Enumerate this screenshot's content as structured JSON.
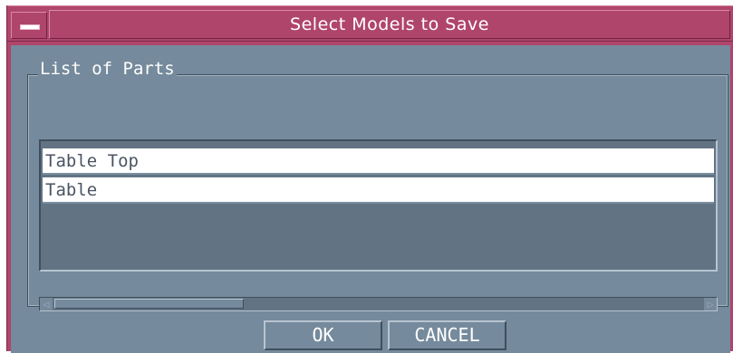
{
  "window": {
    "title": "Select Models to Save"
  },
  "parts_frame": {
    "label": "List of Parts",
    "items": [
      {
        "label": "Table Top"
      },
      {
        "label": "Table"
      }
    ]
  },
  "buttons": {
    "ok": "OK",
    "cancel": "CANCEL"
  },
  "colors": {
    "titlebar": "#b0456c",
    "client_bg": "#758a9c",
    "list_bg": "#627384",
    "item_bg": "#ffffff"
  },
  "icons": {
    "window_menu": "window-menu-icon",
    "scroll_left": "scroll-left-arrow-icon",
    "scroll_right": "scroll-right-arrow-icon"
  }
}
